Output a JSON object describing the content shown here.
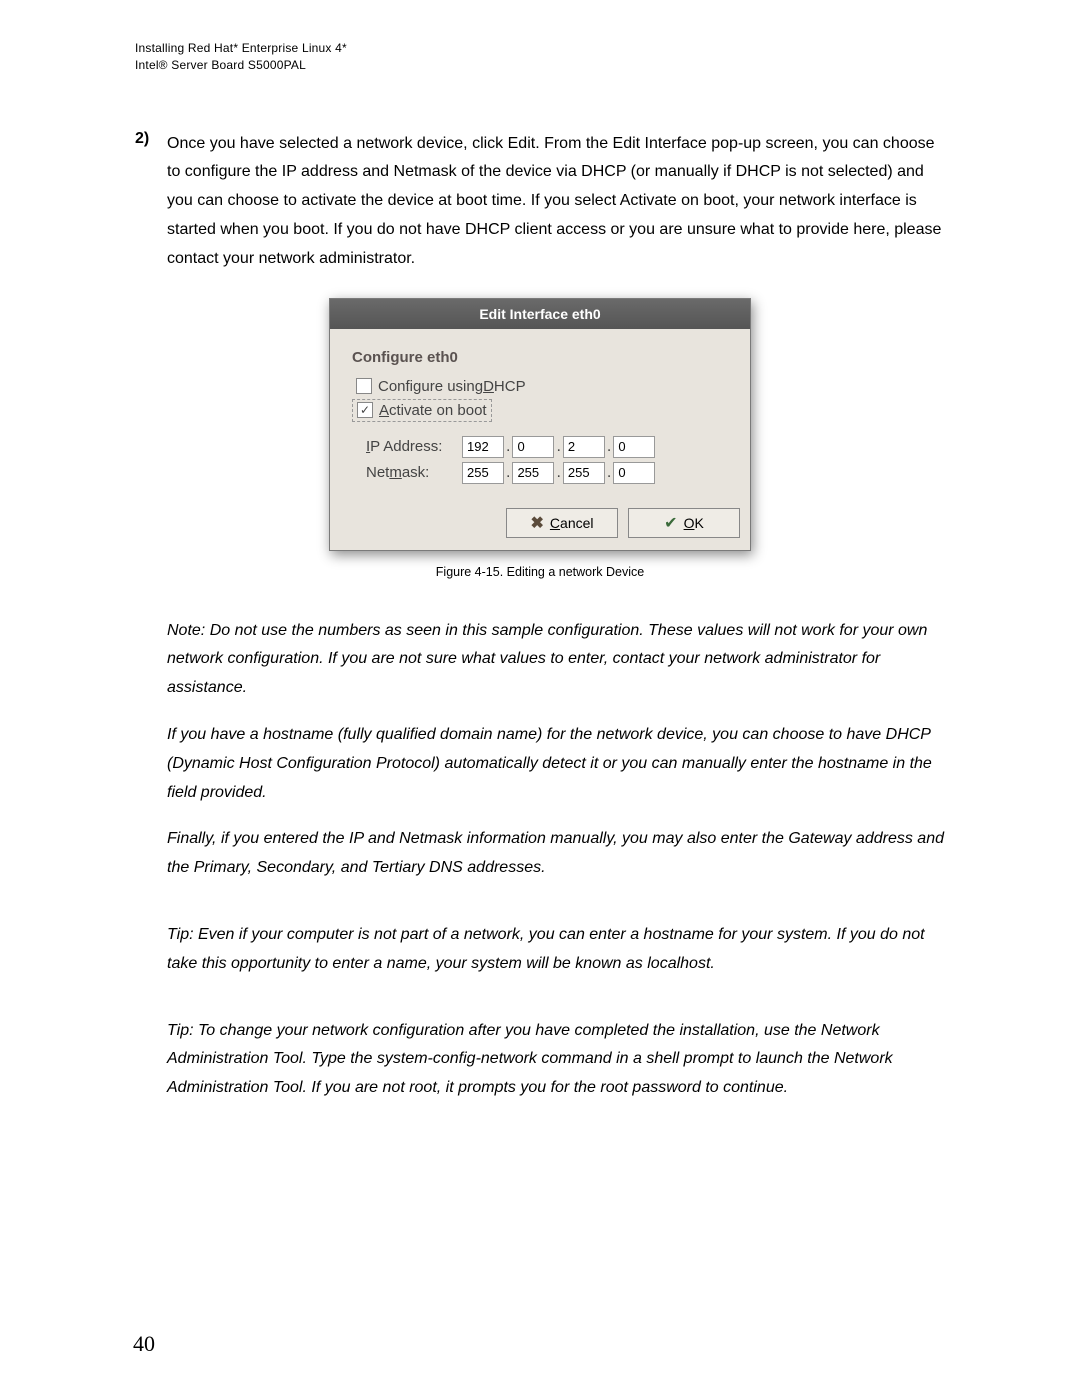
{
  "header": {
    "line1": "Installing Red Hat* Enterprise Linux 4*",
    "line2": "Intel® Server Board S5000PAL"
  },
  "step": {
    "number": "2)",
    "text": "Once you have selected a network device, click Edit. From the Edit Interface pop-up screen, you can choose to configure the IP address and Netmask of the device via DHCP (or manually if DHCP is not selected) and you can choose to activate the device at boot time. If you select Activate on boot, your network interface is started when you boot. If you do not have DHCP client access or you are unsure what to provide here, please contact your network administrator."
  },
  "dialog": {
    "title": "Edit Interface eth0",
    "configure_header": "Configure eth0",
    "dhcp_pre": "Configure using ",
    "dhcp_u": "D",
    "dhcp_post": "HCP",
    "activate_u": "A",
    "activate_post": "ctivate on boot",
    "ip_u": "I",
    "ip_post": "P Address:",
    "nm_pre": "Net",
    "nm_u": "m",
    "nm_post": "ask:",
    "ip": {
      "o1": "192",
      "o2": "0",
      "o3": "2",
      "o4": "0"
    },
    "netmask": {
      "o1": "255",
      "o2": "255",
      "o3": "255",
      "o4": "0"
    },
    "cancel_u": "C",
    "cancel_post": "ancel",
    "ok_u": "O",
    "ok_post": "K"
  },
  "caption": "Figure 4-15. Editing a network Device",
  "notes": {
    "p1": "Note: Do not use the numbers as seen in this sample configuration. These values will not work for your own network configuration. If you are not sure what values to enter, contact your network administrator for assistance.",
    "p2": "If you have a hostname (fully qualified domain name) for the network device, you can choose to have DHCP (Dynamic Host Configuration Protocol) automatically detect it or you can manually enter the hostname in the field provided.",
    "p3": "Finally, if you entered the IP and Netmask information manually, you may also enter the Gateway address and the Primary, Secondary, and Tertiary DNS addresses.",
    "p4": "Tip: Even if your computer is not part of a network, you can enter a hostname for your system. If you do not take this opportunity to enter a name, your system will be known as localhost.",
    "p5": "Tip: To change your network configuration after you have completed the installation, use the Network Administration Tool. Type the system-config-network command in a shell prompt to launch the Network Administration Tool. If you are not root, it prompts you for the root password to continue."
  },
  "page_number": "40"
}
